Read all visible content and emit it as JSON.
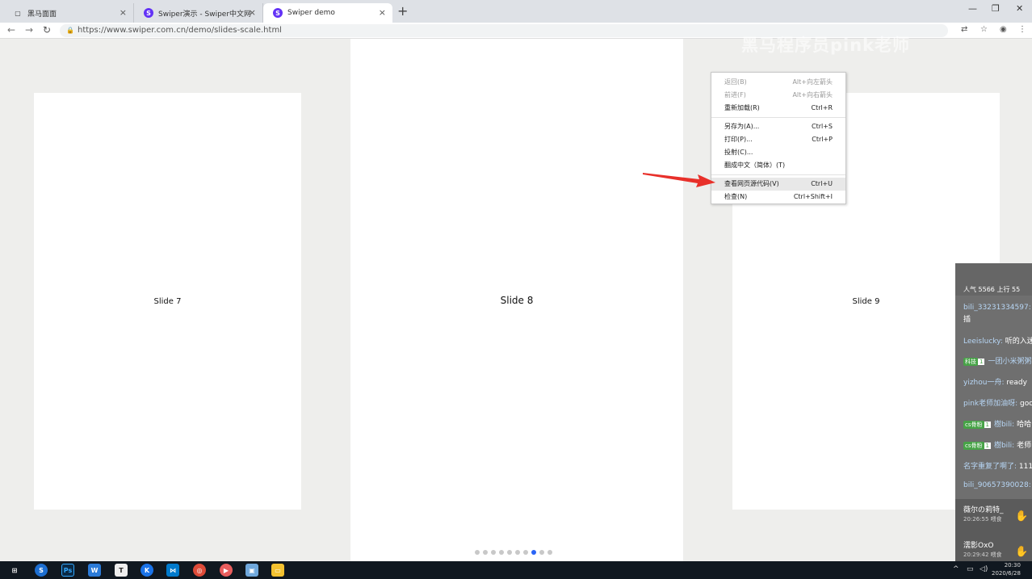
{
  "tabs": [
    {
      "title": "黑马面面",
      "icon": "page-icon",
      "active": false
    },
    {
      "title": "Swiper演示 - Swiper中文网",
      "icon": "swiper-logo-icon",
      "active": false
    },
    {
      "title": "Swiper demo",
      "icon": "swiper-logo-icon",
      "active": true
    }
  ],
  "tab_close": "×",
  "new_tab": "+",
  "address": {
    "url": "https://www.swiper.com.cn/demo/slides-scale.html"
  },
  "watermark": "黑马程序员pink老师",
  "slides": [
    {
      "label": "Slide 7"
    },
    {
      "label": "Slide 8"
    },
    {
      "label": "Slide 9"
    }
  ],
  "pagination": {
    "count": 10,
    "active_index": 7,
    "active_color": "#2a64f6"
  },
  "context_menu": {
    "groups": [
      [
        {
          "label": "返回(B)",
          "shortcut": "Alt+向左箭头",
          "disabled": true
        },
        {
          "label": "前进(F)",
          "shortcut": "Alt+向右箭头",
          "disabled": true
        },
        {
          "label": "重新加载(R)",
          "shortcut": "Ctrl+R",
          "disabled": false
        }
      ],
      [
        {
          "label": "另存为(A)...",
          "shortcut": "Ctrl+S",
          "disabled": false
        },
        {
          "label": "打印(P)...",
          "shortcut": "Ctrl+P",
          "disabled": false
        },
        {
          "label": "投射(C)...",
          "shortcut": "",
          "disabled": false
        },
        {
          "label": "翻成中文（简体）(T)",
          "shortcut": "",
          "disabled": false
        }
      ],
      [
        {
          "label": "查看网页源代码(V)",
          "shortcut": "Ctrl+U",
          "disabled": false,
          "highlighted": true
        },
        {
          "label": "检查(N)",
          "shortcut": "Ctrl+Shift+I",
          "disabled": false
        }
      ]
    ]
  },
  "chat": {
    "stats": "人气  5566    上行  55",
    "messages": [
      {
        "user": "bili_33231334597:",
        "text": "插",
        "badge": ""
      },
      {
        "user": "Leeislucky:",
        "text": "听的入迷",
        "badge": ""
      },
      {
        "user": "一团小米粥粥",
        "text": "",
        "badge": "科技",
        "level": "1"
      },
      {
        "user": "yizhou一舟:",
        "text": "ready",
        "badge": ""
      },
      {
        "user": "pink老师加油呀:",
        "text": "goo",
        "badge": ""
      },
      {
        "user": "樹bili:",
        "text": "哈哈",
        "badge": "cs骨粉",
        "level": "1"
      },
      {
        "user": "樹bili:",
        "text": "老师",
        "badge": "cs骨粉",
        "level": "1"
      },
      {
        "user": "名字重复了啊了:",
        "text": "111",
        "badge": ""
      },
      {
        "user": "bili_90657390028:",
        "text": "",
        "badge": ""
      }
    ],
    "gifts": [
      {
        "name": "薇尔の莉特_",
        "time": "20:26:55 喂食"
      },
      {
        "name": "濡影OxO",
        "time": "20:29:42 喂食"
      }
    ]
  },
  "taskbar": {
    "apps": [
      "windows-start-icon",
      "sogou-icon",
      "photoshop-icon",
      "webstorm-icon",
      "typora-icon",
      "kugou-icon",
      "vscode-icon",
      "chrome-icon",
      "bilibili-live-icon",
      "screen-tool-icon",
      "folder-icon"
    ],
    "time": "20:30",
    "date": "2020/6/28"
  }
}
